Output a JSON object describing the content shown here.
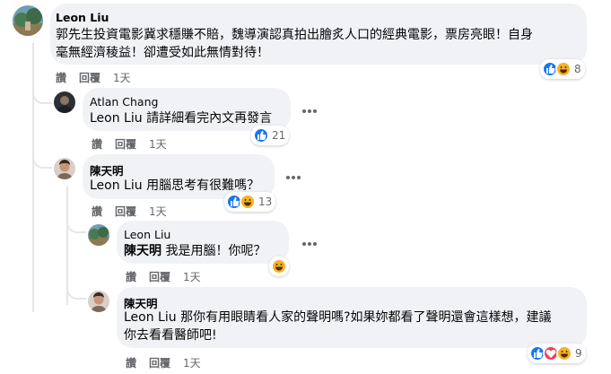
{
  "comments": [
    {
      "author": "Leon Liu",
      "text": "郭先生投資電影冀求穩賺不賠，魏導演認真拍出膾炙人口的經典電影，票房亮眼！自身毫無經濟稜益！卻遭受如此無情對待！",
      "line1": "郭先生投資電影冀求穩賺不賠，魏導演認真拍出膾炙人口的經典電影，票房亮眼！自身",
      "line2": "毫無經濟稜益！卻遭受如此無情對待！",
      "like": "讚",
      "reply": "回覆",
      "time": "1天",
      "reaction_count": "8",
      "reaction_icons": [
        "like",
        "haha"
      ]
    },
    {
      "author": "Atlan Chang",
      "text": "Leon Liu 請詳細看完內文再發言",
      "like": "讚",
      "reply": "回覆",
      "time": "1天",
      "reaction_count": "21",
      "reaction_icons": [
        "like"
      ]
    },
    {
      "author": "陳天明",
      "text": "Leon Liu 用腦思考有很難嗎？",
      "like": "讚",
      "reply": "回覆",
      "time": "1天",
      "reaction_count": "13",
      "reaction_icons": [
        "like",
        "haha"
      ]
    },
    {
      "author": "Leon Liu",
      "mention": "陳天明",
      "text": " 我是用腦！你呢？",
      "like": "讚",
      "reply": "回覆",
      "time": "1天",
      "reaction_count": "",
      "reaction_icons": [
        "haha"
      ]
    },
    {
      "author": "陳天明",
      "line1": "Leon Liu 那你有用眼睛看人家的聲明嗎?如果妳都看了聲明還會這樣想，建議",
      "line2": "你去看看醫師吧!",
      "like": "讚",
      "reply": "回覆",
      "time": "1天",
      "reaction_count": "9",
      "reaction_icons": [
        "like",
        "love",
        "haha"
      ]
    }
  ],
  "colors": {
    "bubble": "#f0f2f5",
    "like_blue": "#1877f2",
    "love_red": "#f33e58",
    "haha_yellow": "#f7b125",
    "secondary_text": "#65676b"
  }
}
